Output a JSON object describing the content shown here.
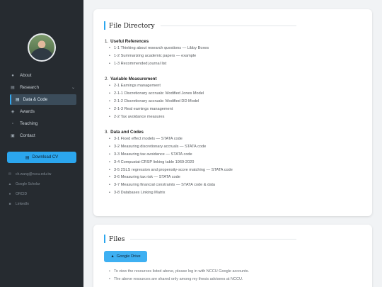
{
  "sidebar": {
    "nav": [
      {
        "label": "About",
        "icon": "person-icon"
      },
      {
        "label": "Research",
        "icon": "list-icon",
        "expanded": true
      },
      {
        "label": "Data & Code",
        "icon": "database-icon",
        "active": true
      },
      {
        "label": "Awards",
        "icon": "award-icon"
      },
      {
        "label": "Teaching",
        "icon": "chat-icon"
      },
      {
        "label": "Contact",
        "icon": "contact-icon"
      }
    ],
    "download_cv": "Download CV",
    "links": [
      {
        "label": "ch.wang@nccu.edu.tw",
        "icon": "mail-icon"
      },
      {
        "label": "Google Scholar",
        "icon": "scholar-icon"
      },
      {
        "label": "ORCID",
        "icon": "orcid-icon"
      },
      {
        "label": "LinkedIn",
        "icon": "linkedin-icon"
      }
    ]
  },
  "file_directory": {
    "title": "File Directory",
    "sections": [
      {
        "num": "1.",
        "name": "Useful References",
        "items": [
          "1-1 Thinking about research questions — Libby Boxes",
          "1-2 Summarizing academic papers — example",
          "1-3 Recommended journal list"
        ]
      },
      {
        "num": "2.",
        "name": "Variable Measurement",
        "items": [
          "2-1 Earnings management",
          "2-1-1 Discretionary accruals: Modified Jones Model",
          "2-1-2 Discretionary accruals: Modified DD Model",
          "2-1-3 Real earnings management",
          "2-2 Tax avoidance measures"
        ]
      },
      {
        "num": "3.",
        "name": "Data and Codes",
        "items": [
          "3-1 Fixed effect models — STATA code",
          "3-2 Measuring discretionary accruals — STATA code",
          "3-3 Measuring tax avoidance — STATA code",
          "3-4 Compustat-CRSP linking table 1969-2020",
          "3-5 2SLS regression and propensity-score matching — STATA code",
          "3-6 Measuring tax risk — STATA code",
          "3-7 Measuring financial constraints — STATA code & data",
          "3-8 Databases Linking Matrix"
        ]
      }
    ]
  },
  "files": {
    "title": "Files",
    "button": "Google Drive",
    "notes": [
      "To view the resources listed above, please log in with NCCU Google accounts.",
      "The above resources are shared only among my thesis advisees at NCCU."
    ]
  },
  "colors": {
    "accent": "#2ba6ee",
    "sidebar_bg": "#262b30",
    "page_bg": "#f1f3f5"
  }
}
